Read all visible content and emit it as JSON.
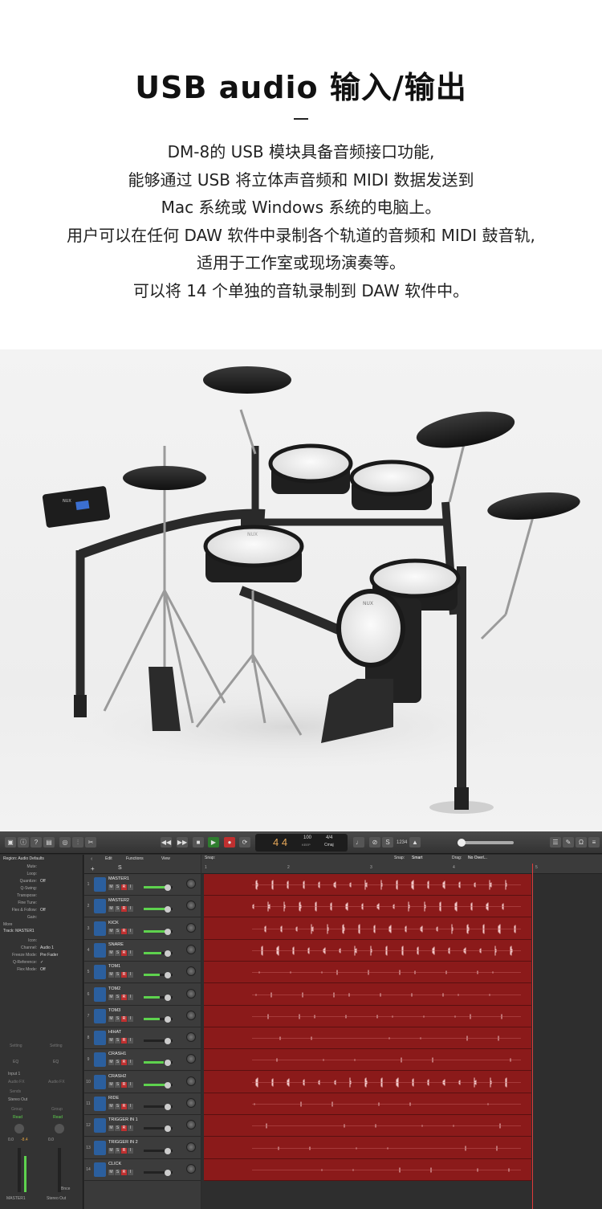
{
  "header": {
    "title": "USB audio 输入/输出",
    "description": [
      "DM-8的 USB 模块具备音频接口功能,",
      "能够通过 USB 将立体声音频和 MIDI 数据发送到",
      "Mac 系统或 Windows 系统的电脑上。",
      "用户可以在任何 DAW 软件中录制各个轨道的音频和 MIDI 鼓音轨,",
      "适用于工作室或现场演奏等。",
      "可以将 14 个单独的音轨录制到 DAW 软件中。"
    ]
  },
  "photo": {
    "module_brand": "NUX",
    "pad_brand": "NUX"
  },
  "daw": {
    "lcd": {
      "bars": "4 4",
      "tempo": "100",
      "tempo_label": "KEEP",
      "signature": "4/4",
      "key": "Cmaj"
    },
    "counter": "1234",
    "menu": {
      "edit": "Edit",
      "functions": "Functions",
      "view": "View"
    },
    "snap_label": "Snap:",
    "snap_value": "Smart",
    "drag_label": "Drag:",
    "drag_value": "No Overl...",
    "inspector": {
      "region_header": "Region: Audio Defaults",
      "region_fields": [
        {
          "k": "Mute:",
          "v": ""
        },
        {
          "k": "Loop:",
          "v": ""
        },
        {
          "k": "Quantize:",
          "v": "Off"
        },
        {
          "k": "Q-Swing:",
          "v": ""
        },
        {
          "k": "Transpose:",
          "v": ""
        },
        {
          "k": "Fine Tune:",
          "v": ""
        },
        {
          "k": "Flex & Follow:",
          "v": "Off"
        },
        {
          "k": "Gain:",
          "v": ""
        }
      ],
      "more": "More",
      "track_header": "Track: MASTER1",
      "track_fields": [
        {
          "k": "Icon:",
          "v": ""
        },
        {
          "k": "Channel:",
          "v": "Audio 1"
        },
        {
          "k": "Freeze Mode:",
          "v": "Pre Fader"
        },
        {
          "k": "Q-Reference:",
          "v": "✓"
        },
        {
          "k": "Flex Mode:",
          "v": "Off"
        }
      ],
      "strip1": {
        "setting": "Setting",
        "eq": "EQ",
        "input": "Input 1",
        "audio_fx": "Audio FX",
        "sends": "Sends",
        "output": "Stereo Out",
        "group": "Group",
        "automation": "Read",
        "vol_a": "0.0",
        "vol_b": "-8.4",
        "name": "MASTER1"
      },
      "strip2": {
        "setting": "Setting",
        "eq": "EQ",
        "audio_fx": "Audio FX",
        "group": "Group",
        "automation": "Read",
        "vol": "0.0",
        "bounce": "Bnce",
        "name": "Stereo Out"
      }
    },
    "ruler": [
      "1",
      "2",
      "3",
      "4",
      "5"
    ],
    "tracks": [
      {
        "num": "1",
        "name": "MASTER1",
        "level": 0.85
      },
      {
        "num": "2",
        "name": "MASTER2",
        "level": 0.85
      },
      {
        "num": "3",
        "name": "KICK",
        "level": 0.75
      },
      {
        "num": "4",
        "name": "SNARE",
        "level": 0.6
      },
      {
        "num": "5",
        "name": "TOM1",
        "level": 0.55
      },
      {
        "num": "6",
        "name": "TOM2",
        "level": 0.55
      },
      {
        "num": "7",
        "name": "TOM3",
        "level": 0.55
      },
      {
        "num": "8",
        "name": "HIHAT",
        "level": 0
      },
      {
        "num": "9",
        "name": "CRASH1",
        "level": 0.7
      },
      {
        "num": "10",
        "name": "CRASH2",
        "level": 0.75
      },
      {
        "num": "11",
        "name": "RIDE",
        "level": 0
      },
      {
        "num": "12",
        "name": "TRIGGER IN 1",
        "level": 0
      },
      {
        "num": "13",
        "name": "TRIGGER IN 2",
        "level": 0
      },
      {
        "num": "14",
        "name": "CLICK",
        "level": 0
      }
    ]
  }
}
